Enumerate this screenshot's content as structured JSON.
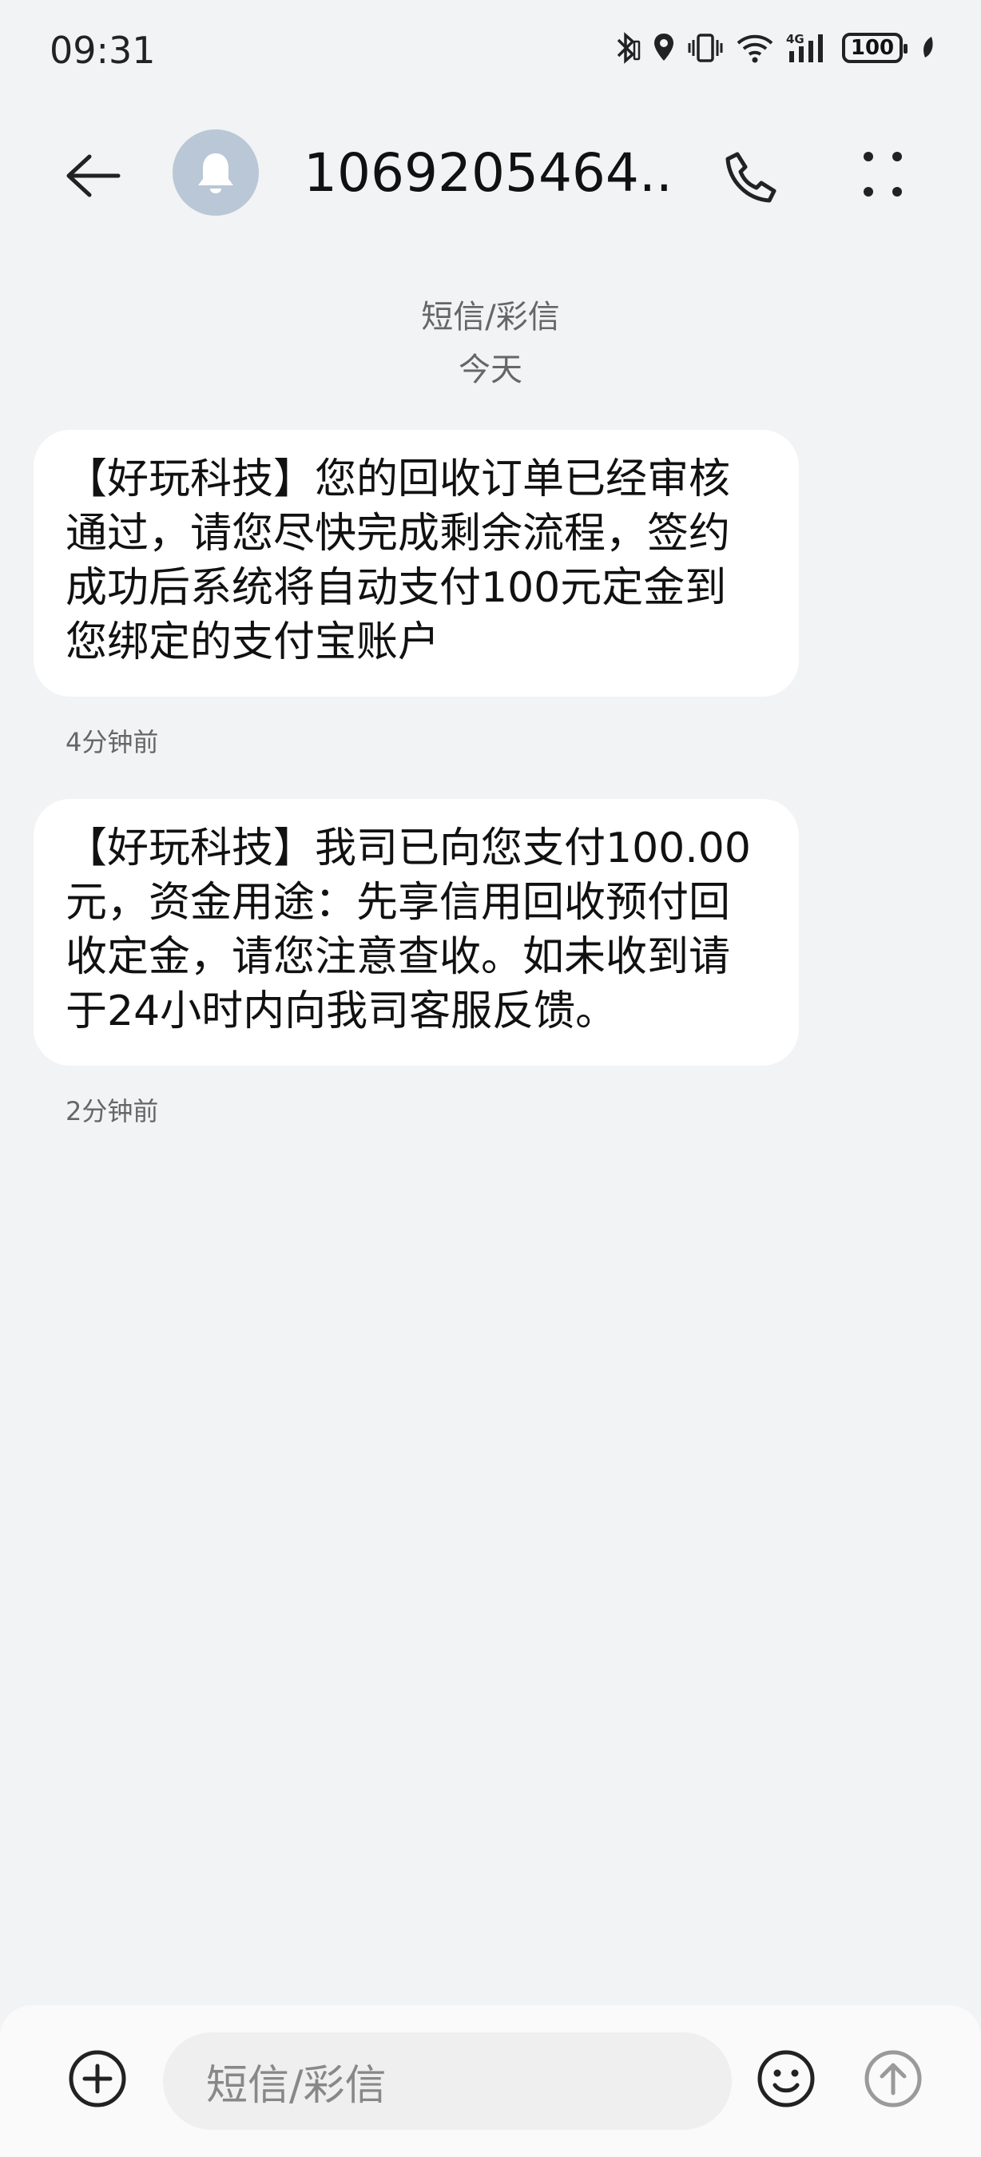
{
  "status_bar": {
    "time": "09:31",
    "battery": "100"
  },
  "header": {
    "contact": "1069205464..."
  },
  "conversation": {
    "type_label": "短信/彩信",
    "day_label": "今天",
    "messages": [
      {
        "text": "【好玩科技】您的回收订单已经审核通过，请您尽快完成剩余流程，签约成功后系统将自动支付100元定金到您绑定的支付宝账户",
        "time": "4分钟前"
      },
      {
        "text": "【好玩科技】我司已向您支付100.00元，资金用途：先享信用回收预付回收定金，请您注意查收。如未收到请于24小时内向我司客服反馈。",
        "time": "2分钟前"
      }
    ]
  },
  "compose": {
    "placeholder": "短信/彩信"
  },
  "icons": [
    "bluetooth-icon",
    "vibrate-icon",
    "location-icon",
    "wifi-icon",
    "signal-icon",
    "battery-icon",
    "leaf-icon",
    "back-arrow-icon",
    "bell-icon",
    "phone-icon",
    "more-icon",
    "add-icon",
    "emoji-icon",
    "send-icon"
  ],
  "colors": {
    "background": "#f1f3f5",
    "bubble": "#ffffff",
    "avatar": "#b9c7d6",
    "text": "#111111",
    "muted": "#666666"
  }
}
